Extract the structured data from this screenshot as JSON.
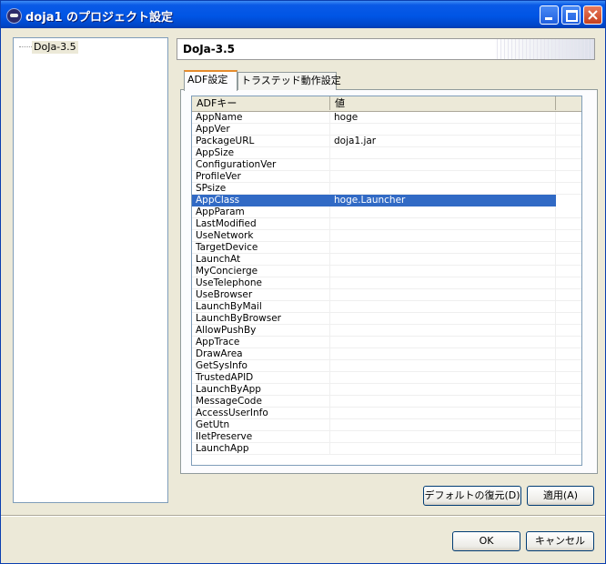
{
  "window": {
    "title": "doja1 のプロジェクト設定"
  },
  "tree": {
    "items": [
      {
        "label": "DoJa-3.5"
      }
    ]
  },
  "header": {
    "title": "DoJa-3.5"
  },
  "tabs": [
    {
      "label": "ADF設定"
    },
    {
      "label": "トラステッド動作設定"
    }
  ],
  "table": {
    "columns": [
      "ADFキー",
      "値"
    ],
    "rows": [
      {
        "key": "AppName",
        "value": "hoge"
      },
      {
        "key": "AppVer",
        "value": ""
      },
      {
        "key": "PackageURL",
        "value": "doja1.jar"
      },
      {
        "key": "AppSize",
        "value": ""
      },
      {
        "key": "ConfigurationVer",
        "value": ""
      },
      {
        "key": "ProfileVer",
        "value": ""
      },
      {
        "key": "SPsize",
        "value": ""
      },
      {
        "key": "AppClass",
        "value": "hoge.Launcher"
      },
      {
        "key": "AppParam",
        "value": ""
      },
      {
        "key": "LastModified",
        "value": ""
      },
      {
        "key": "UseNetwork",
        "value": ""
      },
      {
        "key": "TargetDevice",
        "value": ""
      },
      {
        "key": "LaunchAt",
        "value": ""
      },
      {
        "key": "MyConcierge",
        "value": ""
      },
      {
        "key": "UseTelephone",
        "value": ""
      },
      {
        "key": "UseBrowser",
        "value": ""
      },
      {
        "key": "LaunchByMail",
        "value": ""
      },
      {
        "key": "LaunchByBrowser",
        "value": ""
      },
      {
        "key": "AllowPushBy",
        "value": ""
      },
      {
        "key": "AppTrace",
        "value": ""
      },
      {
        "key": "DrawArea",
        "value": ""
      },
      {
        "key": "GetSysInfo",
        "value": ""
      },
      {
        "key": "TrustedAPID",
        "value": ""
      },
      {
        "key": "LaunchByApp",
        "value": ""
      },
      {
        "key": "MessageCode",
        "value": ""
      },
      {
        "key": "AccessUserInfo",
        "value": ""
      },
      {
        "key": "GetUtn",
        "value": ""
      },
      {
        "key": "IletPreserve",
        "value": ""
      },
      {
        "key": "LaunchApp",
        "value": ""
      }
    ],
    "selected_key": "AppClass"
  },
  "buttons": {
    "restore_defaults": "デフォルトの復元(D)",
    "apply": "適用(A)",
    "ok": "OK",
    "cancel": "キャンセル"
  },
  "colors": {
    "selection": "#316ac5",
    "titlebar": "#0055e5",
    "active_tab_accent": "#e68b2c"
  }
}
